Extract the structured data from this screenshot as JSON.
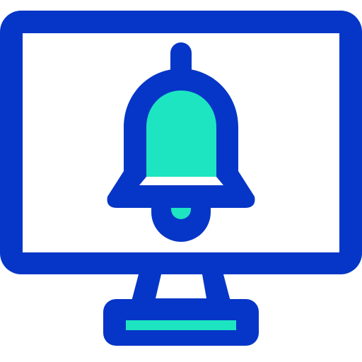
{
  "icon": {
    "name": "monitor-notification-bell-icon",
    "parts": [
      "monitor-icon",
      "bell-icon",
      "stand-icon"
    ]
  },
  "colors": {
    "outline": "#0636c7",
    "fill": "#1de5c1",
    "screen": "#ffffff",
    "background": "#ffffff"
  }
}
